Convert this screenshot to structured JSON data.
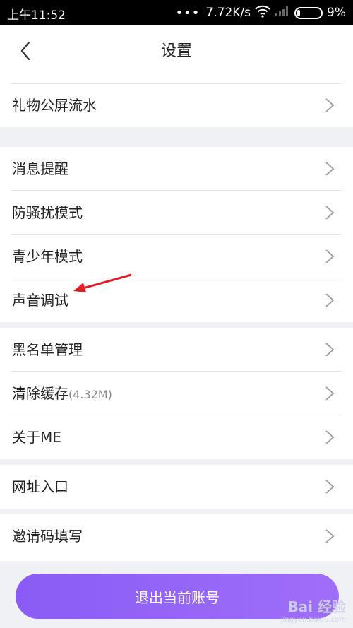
{
  "status_bar": {
    "time": "上午11:52",
    "network_speed": "7.72K/s",
    "battery": "9%"
  },
  "header": {
    "title": "设置"
  },
  "groups": [
    {
      "items": [
        {
          "label": "礼物公屏流水"
        }
      ]
    },
    {
      "items": [
        {
          "label": "消息提醒"
        },
        {
          "label": "防骚扰模式"
        },
        {
          "label": "青少年模式"
        },
        {
          "label": "声音调试"
        }
      ]
    },
    {
      "items": [
        {
          "label": "黑名单管理"
        },
        {
          "label": "清除缓存",
          "sub": "(4.32M)"
        },
        {
          "label": "关于ME"
        }
      ]
    },
    {
      "items": [
        {
          "label": "网址入口"
        }
      ]
    },
    {
      "items": [
        {
          "label": "邀请码填写"
        }
      ]
    }
  ],
  "logout": {
    "label": "退出当前账号"
  },
  "watermark": {
    "brand": "Bai 经验",
    "url": "jingyan.baidu.com"
  },
  "colors": {
    "accent": "#8b5cf6",
    "separator": "#f0f1f5",
    "annotation_arrow": "#e0202a"
  }
}
